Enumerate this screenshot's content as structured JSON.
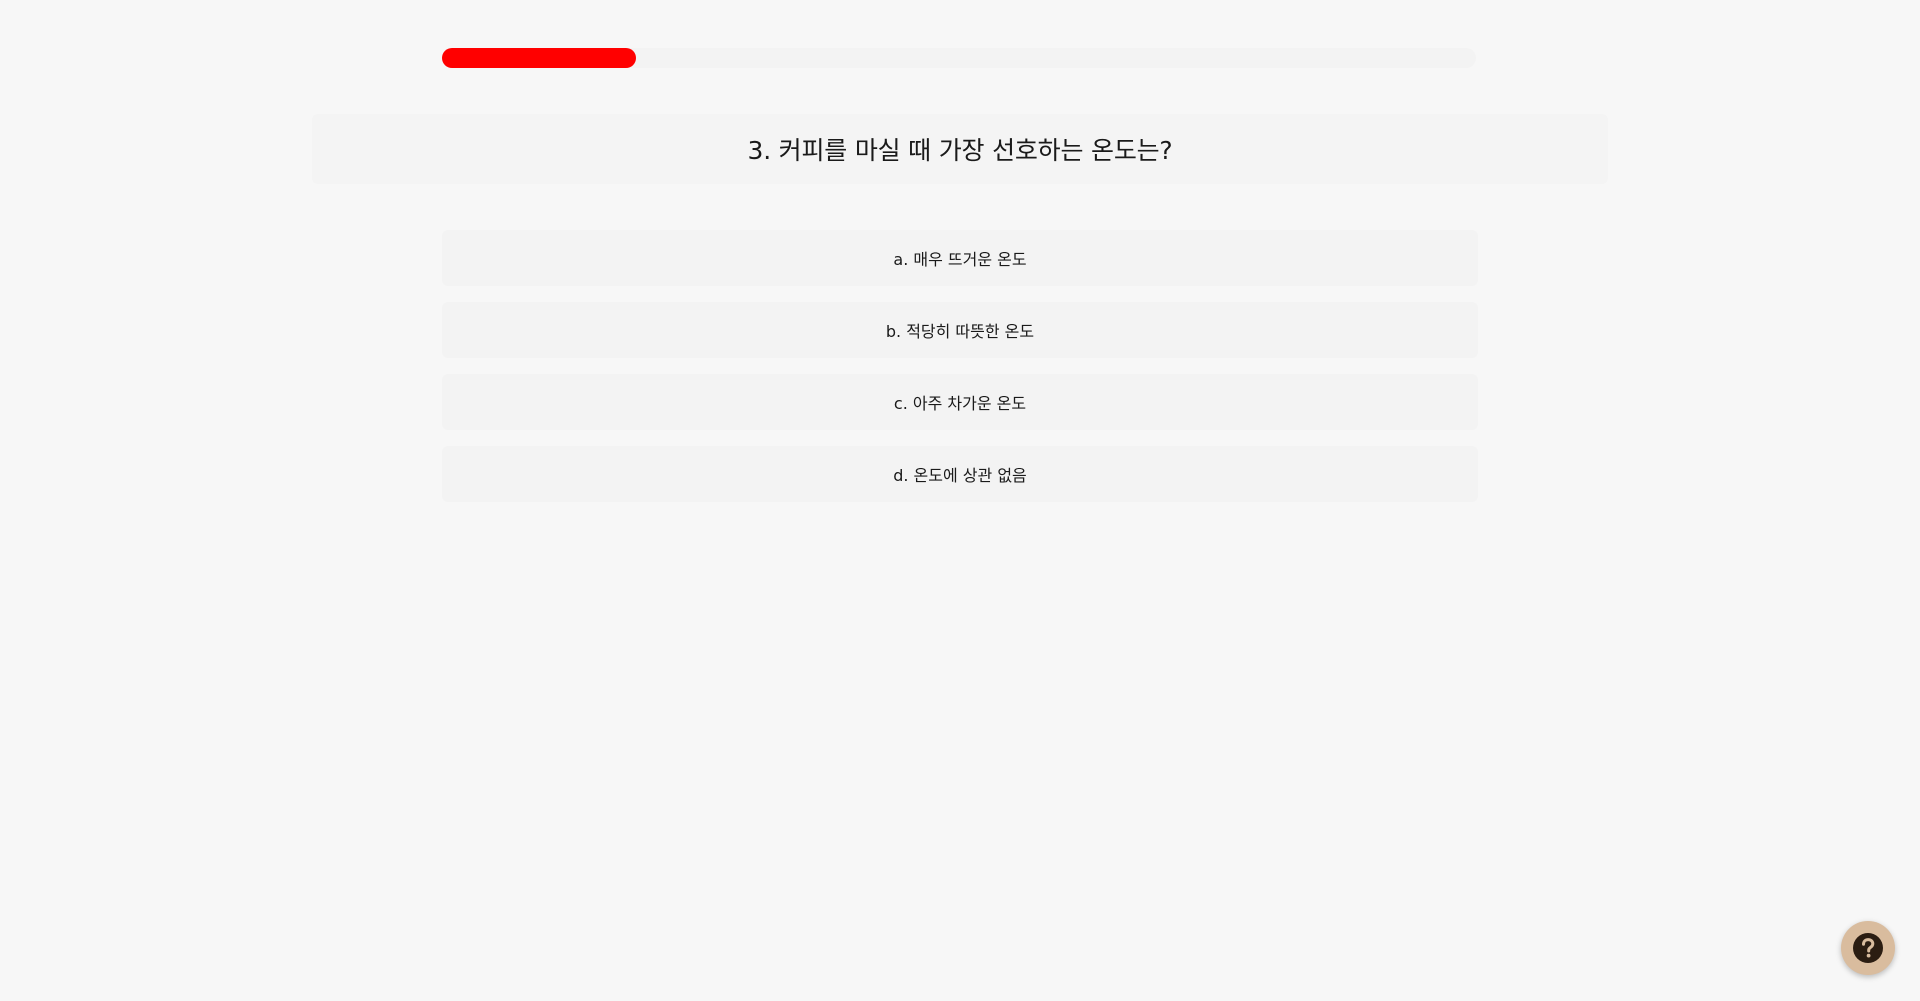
{
  "progress": {
    "fraction": 0.188,
    "color": "#ff0000"
  },
  "question": {
    "text": "3. 커피를 마실 때 가장 선호하는 온도는?"
  },
  "options": [
    {
      "label": "a. 매우 뜨거운 온도"
    },
    {
      "label": "b. 적당히 따뜻한 온도"
    },
    {
      "label": "c. 아주 차가운 온도"
    },
    {
      "label": "d. 온도에 상관 없음"
    }
  ],
  "help": {
    "icon": "question-mark-icon",
    "color": "#d9bc9e"
  }
}
